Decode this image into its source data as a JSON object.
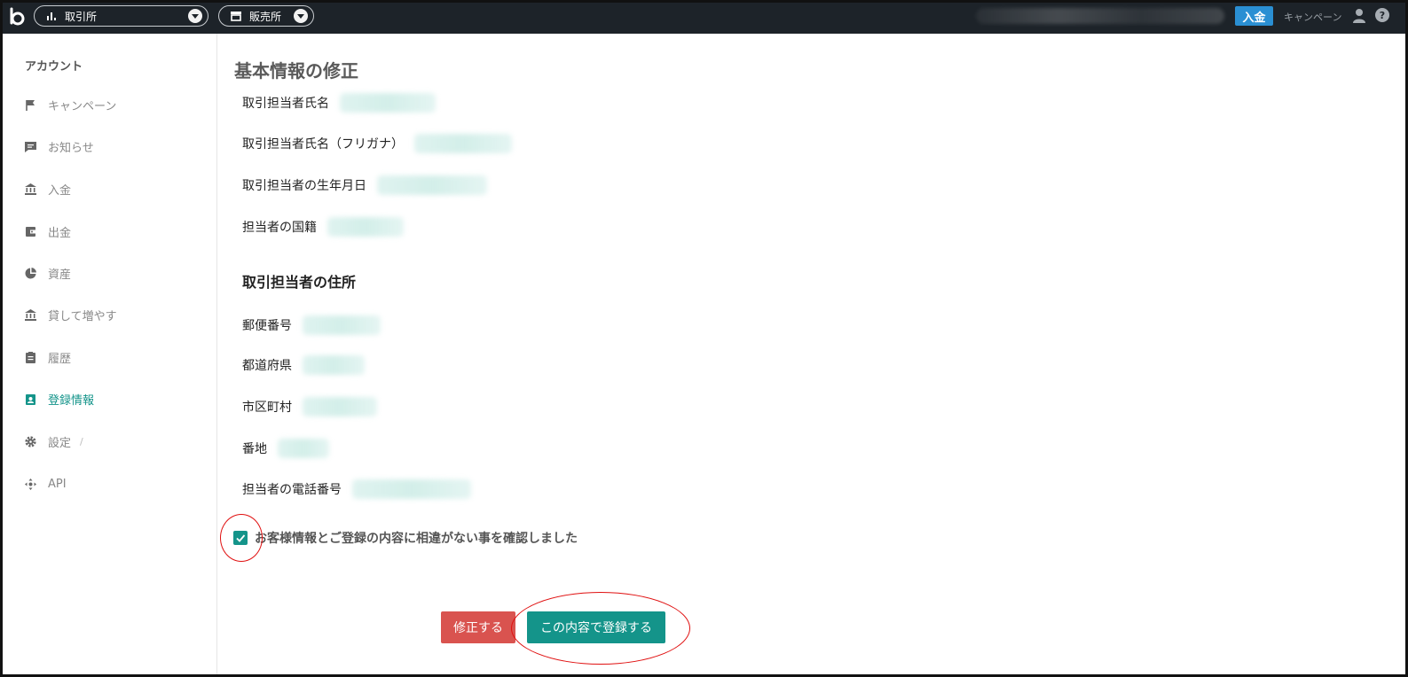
{
  "topbar": {
    "exchange_label": "取引所",
    "sales_label": "販売所",
    "deposit_label": "入金",
    "campaign_label": "キャンペーン",
    "help_glyph": "?"
  },
  "sidebar": {
    "heading": "アカウント",
    "items": [
      {
        "label": "キャンペーン",
        "icon": "flag-icon"
      },
      {
        "label": "お知らせ",
        "icon": "message-icon"
      },
      {
        "label": "入金",
        "icon": "bank-icon"
      },
      {
        "label": "出金",
        "icon": "wallet-icon"
      },
      {
        "label": "資産",
        "icon": "pie-chart-icon"
      },
      {
        "label": "貸して増やす",
        "icon": "bank-icon"
      },
      {
        "label": "履歴",
        "icon": "clipboard-icon"
      },
      {
        "label": "登録情報",
        "icon": "badge-icon",
        "active": true
      },
      {
        "label": "設定",
        "icon": "gear-icon",
        "suffix": "/"
      },
      {
        "label": "API",
        "icon": "api-icon"
      }
    ],
    "active_color": "#14948a"
  },
  "main": {
    "title": "基本情報の修正",
    "fields": [
      {
        "label": "取引担当者氏名"
      },
      {
        "label": "取引担当者氏名（フリガナ）"
      },
      {
        "label": "取引担当者の生年月日"
      },
      {
        "label": "担当者の国籍"
      }
    ],
    "address_heading": "取引担当者の住所",
    "address_fields": [
      {
        "label": "郵便番号"
      },
      {
        "label": "都道府県"
      },
      {
        "label": "市区町村"
      },
      {
        "label": "番地"
      },
      {
        "label": "担当者の電話番号"
      }
    ],
    "confirm_text": "お客様情報とご登録の内容に相違がない事を確認しました",
    "confirm_checked": true,
    "edit_button": "修正する",
    "submit_button": "この内容で登録する"
  },
  "colors": {
    "topbar_bg": "#1d2329",
    "deposit_blue": "#2a8fd3",
    "accent_teal": "#14948a",
    "edit_red": "#d9534f",
    "annotation_red": "#e01010"
  }
}
